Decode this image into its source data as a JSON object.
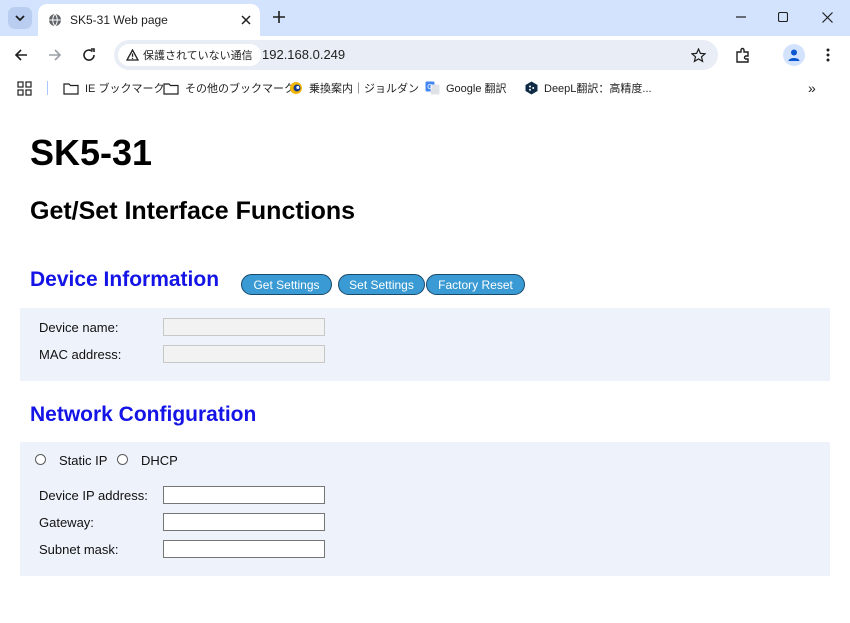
{
  "browser": {
    "tab_title": "SK5-31 Web page",
    "security_label": "保護されていない通信",
    "url": "192.168.0.249",
    "bookmarks": [
      {
        "label": "IE ブックマーク",
        "icon": "folder-icon"
      },
      {
        "label": "その他のブックマーク",
        "icon": "folder-icon"
      },
      {
        "label": "乗換案内｜ジョルダン",
        "icon": "jorudan-icon"
      },
      {
        "label": "Google 翻訳",
        "icon": "google-translate-icon"
      },
      {
        "label": "DeepL翻訳：高精度...",
        "icon": "deepl-icon"
      }
    ],
    "more_bookmarks": "»"
  },
  "page": {
    "title": "SK5-31",
    "subtitle": "Get/Set Interface Functions",
    "device_info": {
      "heading": "Device Information",
      "buttons": {
        "get": "Get Settings",
        "set": "Set Settings",
        "reset": "Factory Reset"
      },
      "device_name_label": "Device name:",
      "device_name_value": "",
      "mac_label": "MAC address:",
      "mac_value": ""
    },
    "network": {
      "heading": "Network Configuration",
      "static_ip_label": "Static IP",
      "dhcp_label": "DHCP",
      "ip_label": "Device IP address:",
      "ip_value": "",
      "gateway_label": "Gateway:",
      "gateway_value": "",
      "subnet_label": "Subnet mask:",
      "subnet_value": ""
    }
  }
}
